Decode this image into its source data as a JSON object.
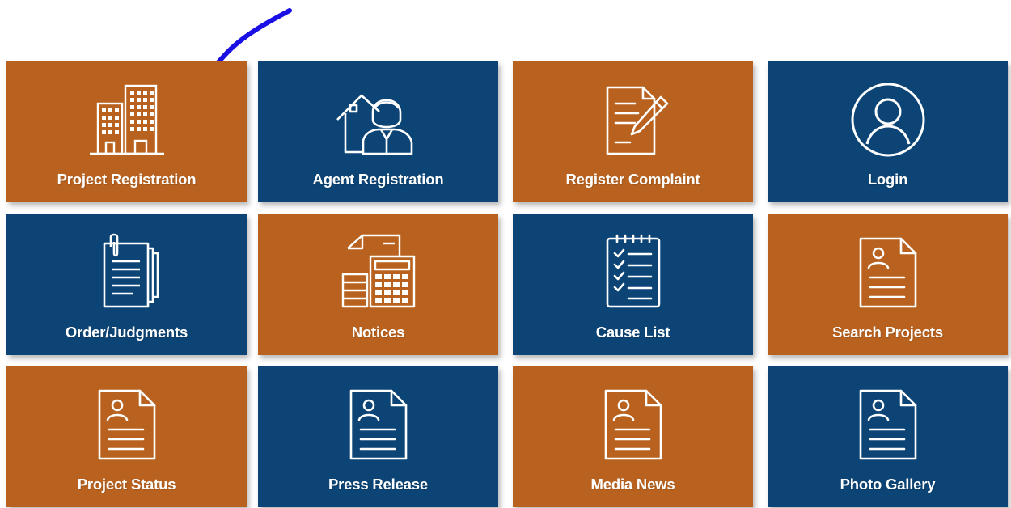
{
  "colors": {
    "orange_tile": "#b9621f",
    "blue_tile": "#0c4475",
    "annotation_arrow": "#1a10e6"
  },
  "tiles": [
    {
      "label": "Project Registration",
      "icon": "buildings-icon",
      "color": "orange"
    },
    {
      "label": "Agent Registration",
      "icon": "agent-house-icon",
      "color": "blue"
    },
    {
      "label": "Register Complaint",
      "icon": "document-pen-icon",
      "color": "orange"
    },
    {
      "label": "Login",
      "icon": "user-circle-icon",
      "color": "blue"
    },
    {
      "label": "Order/Judgments",
      "icon": "clipped-documents-icon",
      "color": "blue"
    },
    {
      "label": "Notices",
      "icon": "notice-calculator-icon",
      "color": "orange"
    },
    {
      "label": "Cause List",
      "icon": "checklist-icon",
      "color": "blue"
    },
    {
      "label": "Search Projects",
      "icon": "profile-document-icon",
      "color": "orange"
    },
    {
      "label": "Project Status",
      "icon": "profile-document-icon",
      "color": "orange"
    },
    {
      "label": "Press Release",
      "icon": "profile-document-icon",
      "color": "blue"
    },
    {
      "label": "Media News",
      "icon": "profile-document-icon",
      "color": "orange"
    },
    {
      "label": "Photo Gallery",
      "icon": "profile-document-icon",
      "color": "blue"
    }
  ]
}
